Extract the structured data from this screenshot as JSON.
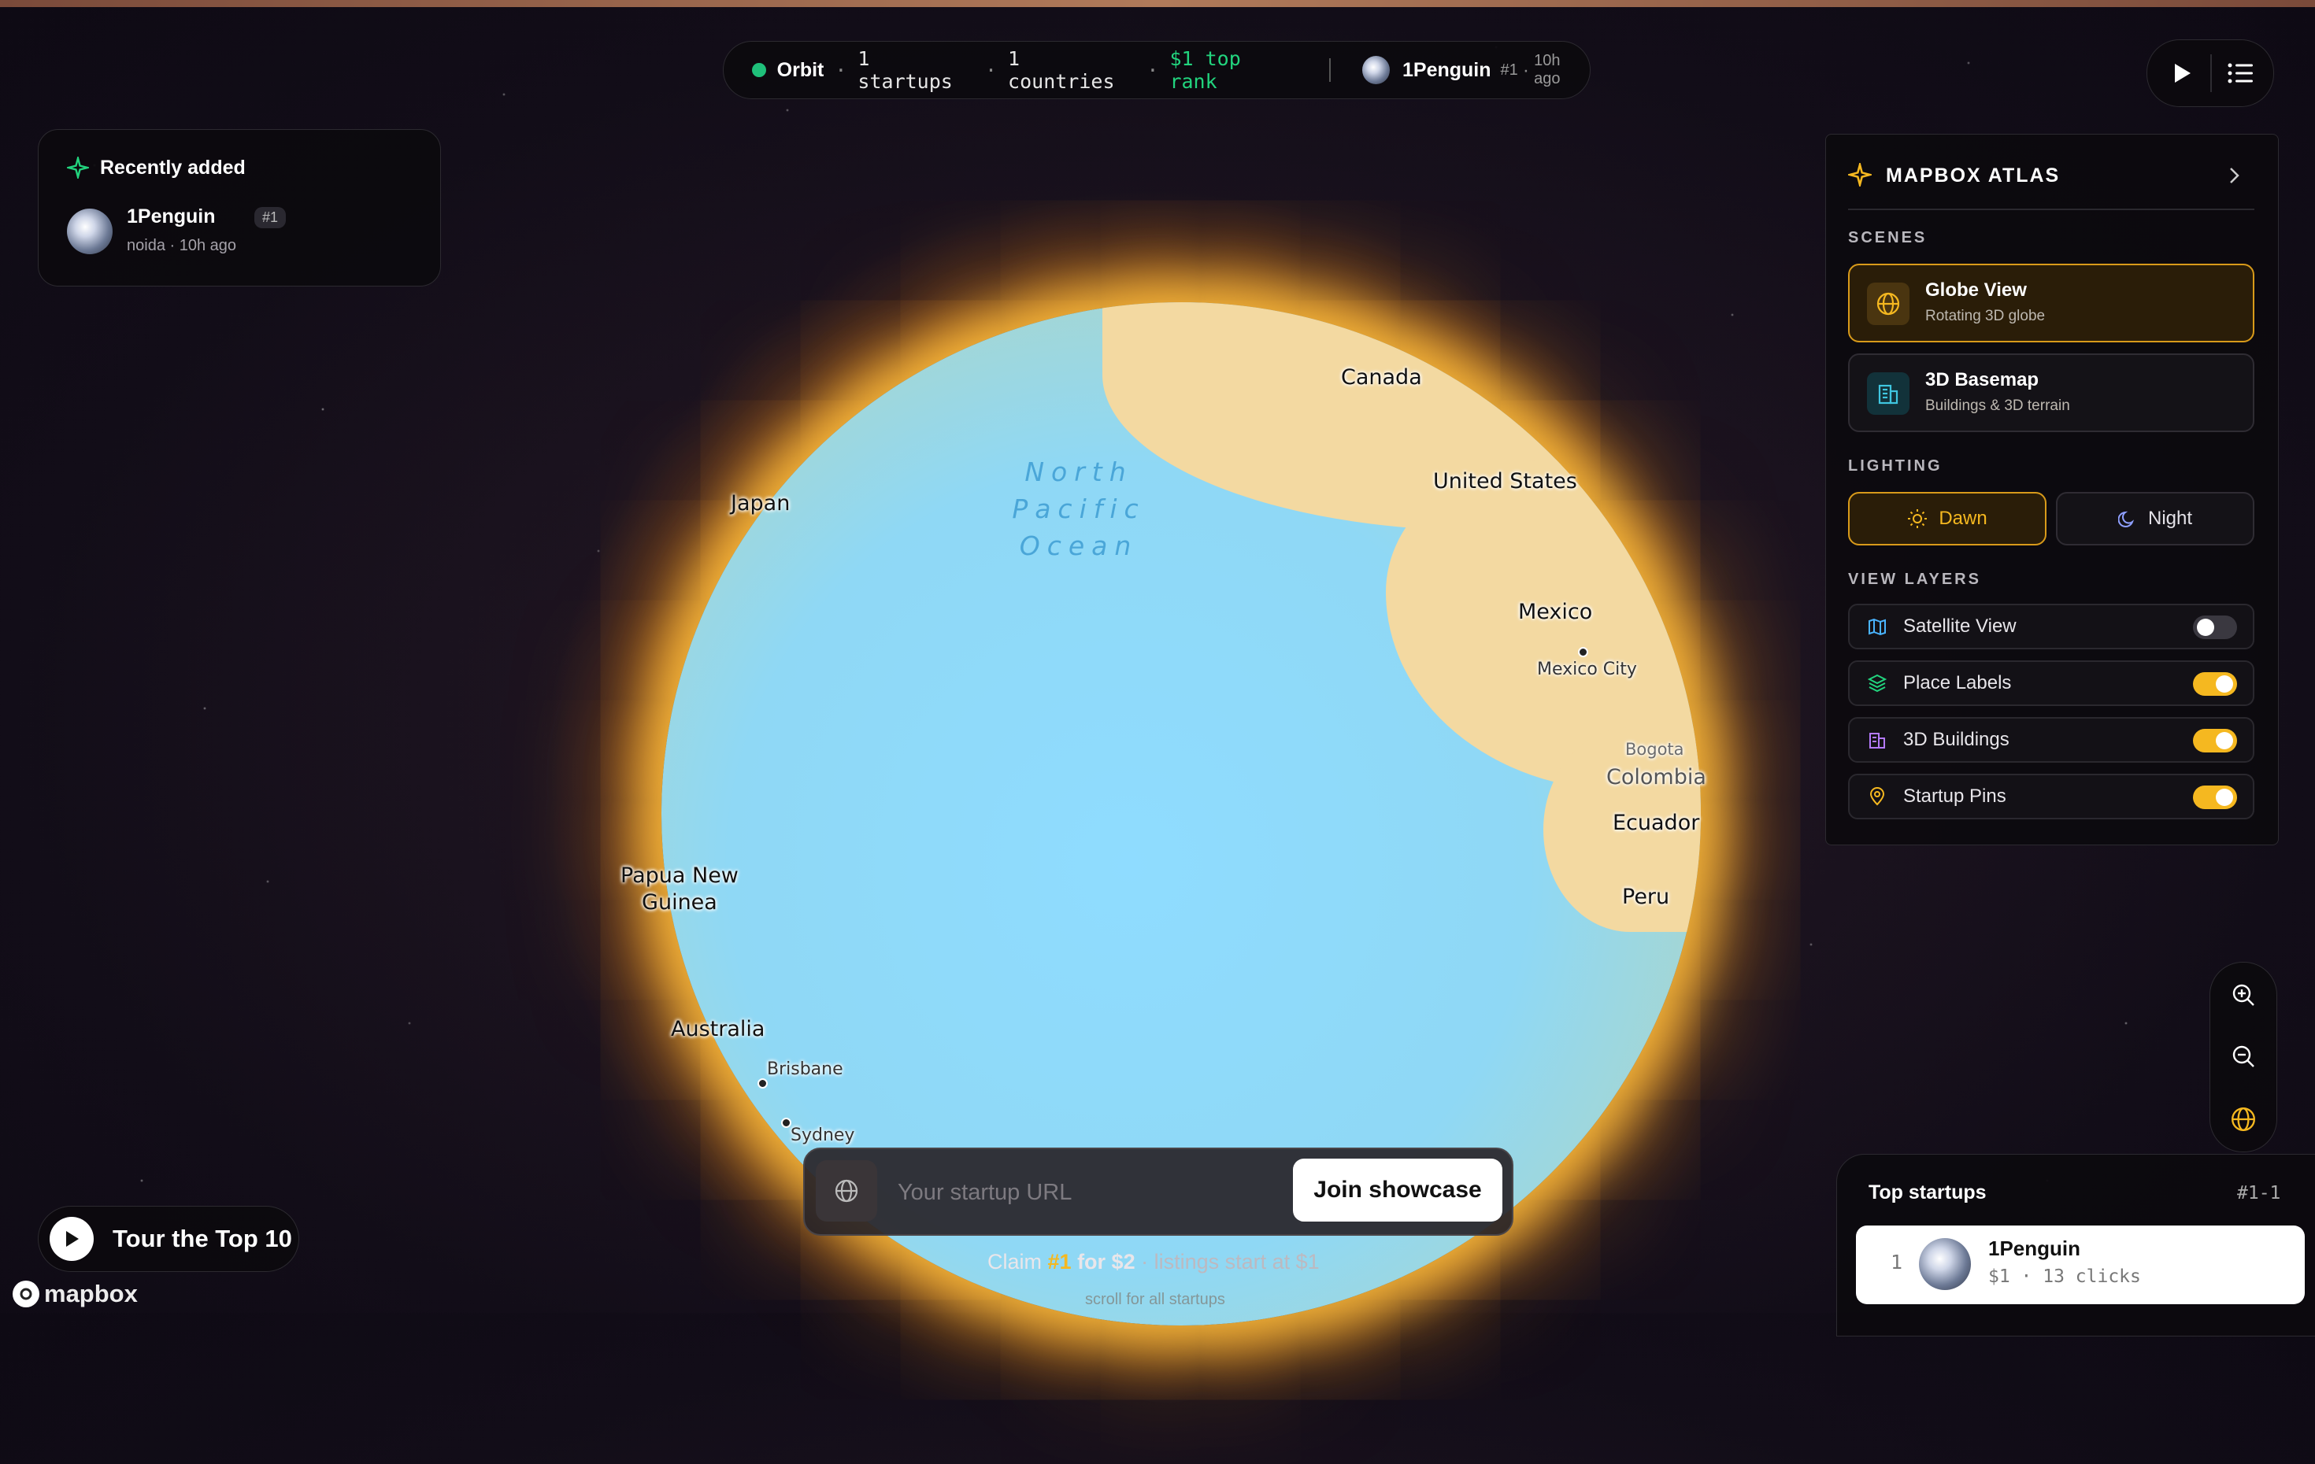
{
  "status_bar": {
    "app_name": "Orbit",
    "startups": "1 startups",
    "countries": "1 countries",
    "top_rank": "$1 top rank",
    "latest_name": "1Penguin",
    "latest_rank": "#1",
    "latest_time": "10h ago",
    "separator": "·"
  },
  "recent": {
    "title": "Recently added",
    "item": {
      "name": "1Penguin",
      "rank": "#1",
      "meta": "noida · 10h ago"
    }
  },
  "map": {
    "ocean_label": [
      "North",
      "Pacific",
      "Ocean"
    ],
    "labels": {
      "canada": "Canada",
      "us": "United States",
      "japan": "Japan",
      "mexico": "Mexico",
      "mexico_city": "Mexico City",
      "bogota": "Bogota",
      "colombia": "Colombia",
      "ecuador": "Ecuador",
      "peru": "Peru",
      "png": "Papua New\nGuinea",
      "australia": "Australia",
      "brisbane": "Brisbane",
      "sydney": "Sydney"
    }
  },
  "atlas": {
    "title": "MAPBOX ATLAS",
    "scenes_heading": "SCENES",
    "scenes": [
      {
        "title": "Globe View",
        "subtitle": "Rotating 3D globe",
        "active": true
      },
      {
        "title": "3D Basemap",
        "subtitle": "Buildings & 3D terrain",
        "active": false
      }
    ],
    "lighting_heading": "LIGHTING",
    "lighting": {
      "dawn": "Dawn",
      "night": "Night",
      "selected": "Dawn"
    },
    "layers_heading": "VIEW LAYERS",
    "layers": [
      {
        "label": "Satellite View",
        "on": false
      },
      {
        "label": "Place Labels",
        "on": true
      },
      {
        "label": "3D Buildings",
        "on": true
      },
      {
        "label": "Startup Pins",
        "on": true
      }
    ]
  },
  "tour": {
    "label": "Tour the Top 10"
  },
  "url_bar": {
    "placeholder": "Your startup URL",
    "button": "Join showcase"
  },
  "claim": {
    "prefix": "Claim ",
    "rank": "#1",
    "middle": " for $2",
    "suffix": " · listings start at $1",
    "hint": "scroll for all startups"
  },
  "top_startups": {
    "title": "Top startups",
    "range": "#1-1",
    "items": [
      {
        "position": "1",
        "name": "1Penguin",
        "meta": "$1 · 13 clicks"
      }
    ]
  },
  "brand": {
    "mapbox": "mapbox"
  },
  "colors": {
    "accent": "#f5b820",
    "green": "#1fc07a"
  }
}
